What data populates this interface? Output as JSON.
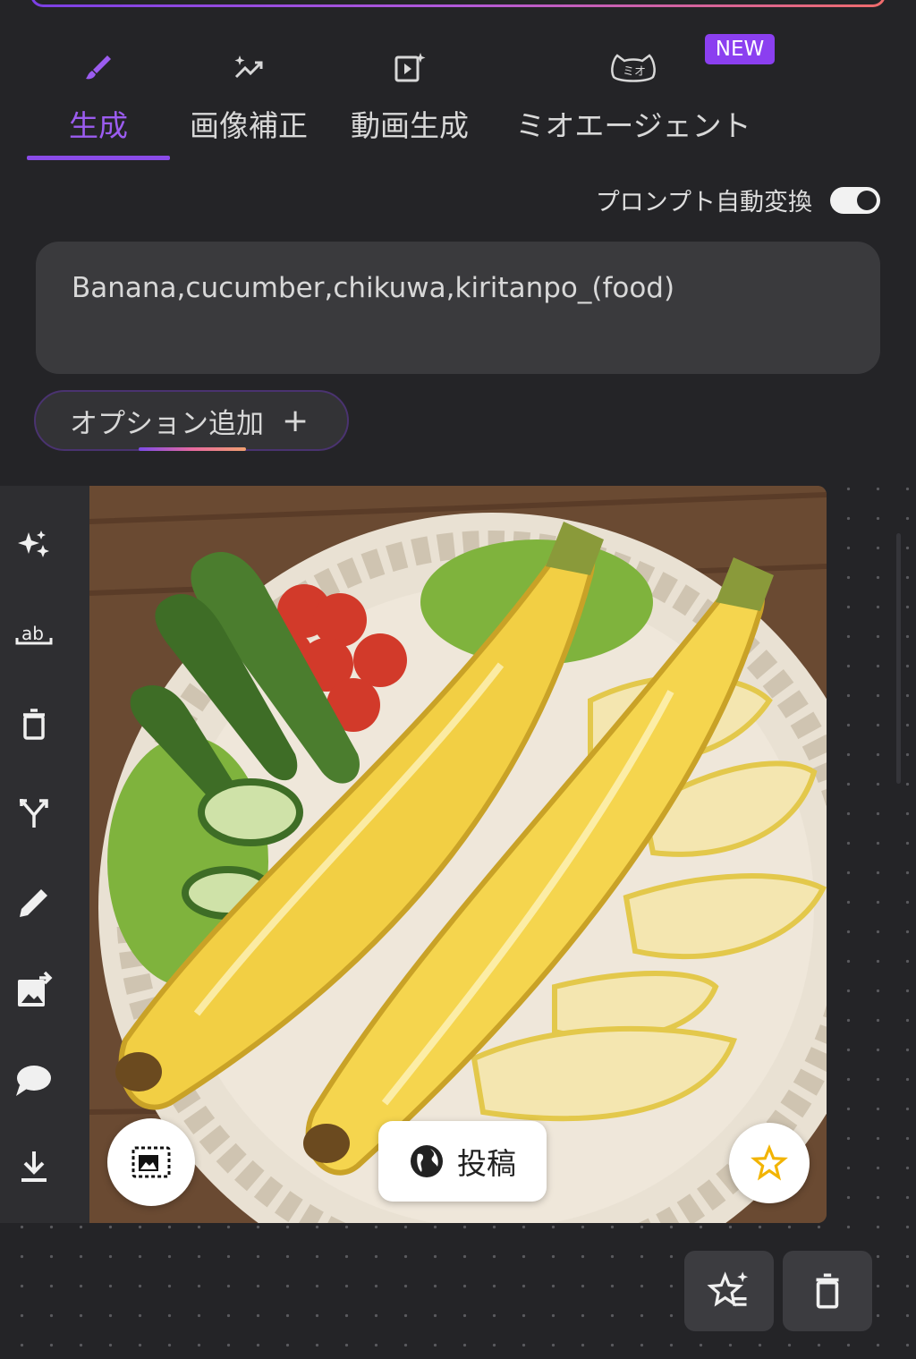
{
  "tabs": [
    {
      "label": "生成",
      "icon": "brush-icon",
      "active": true
    },
    {
      "label": "画像補正",
      "icon": "sparkle-trend-icon",
      "active": false
    },
    {
      "label": "動画生成",
      "icon": "video-sparkle-icon",
      "active": false
    },
    {
      "label": "ミオエージェント",
      "icon": "cat-face-icon",
      "active": false
    }
  ],
  "badge": "NEW",
  "auto_convert": {
    "label": "プロンプト自動変換",
    "enabled": true
  },
  "prompt": {
    "text": "Banana,cucumber,chikuwa,kiritanpo_(food)"
  },
  "option_button": {
    "label": "オプション追加",
    "plus": "+"
  },
  "toolbar": [
    {
      "name": "sparkles-icon"
    },
    {
      "name": "text-edit-icon",
      "text": "ab"
    },
    {
      "name": "trash-icon"
    },
    {
      "name": "branch-icon"
    },
    {
      "name": "pencil-icon"
    },
    {
      "name": "image-export-icon"
    },
    {
      "name": "chat-bubble-icon"
    },
    {
      "name": "download-icon"
    }
  ],
  "image": {
    "alt": "banana-cucumber-plate"
  },
  "post_button": {
    "label": "投稿",
    "icon": "globe-icon"
  },
  "colors": {
    "accent": "#8a4be8",
    "badge": "#8b3ff0",
    "background": "#242427",
    "star": "#f2b400"
  }
}
